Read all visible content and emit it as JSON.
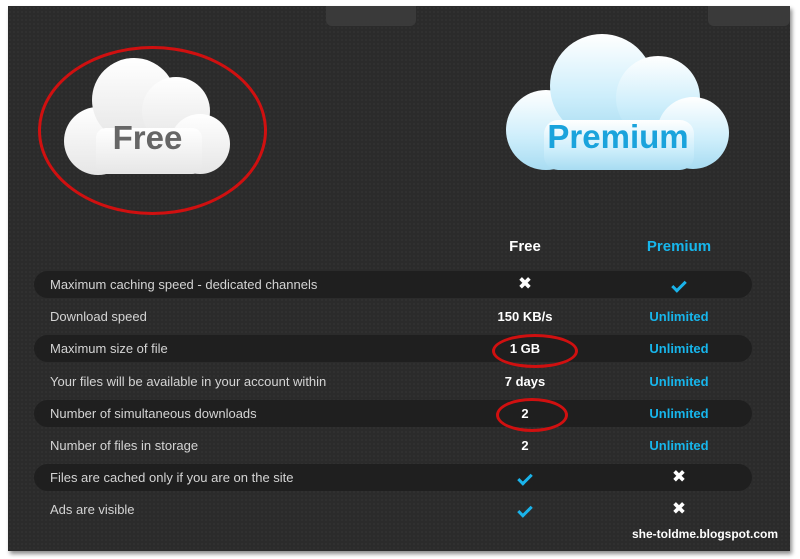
{
  "plans": {
    "free_cloud_label": "Free",
    "premium_cloud_label": "Premium"
  },
  "table": {
    "headers": {
      "free": "Free",
      "premium": "Premium"
    },
    "rows": [
      {
        "feature": "Maximum caching speed - dedicated channels",
        "free": {
          "type": "cross"
        },
        "premium": {
          "type": "check"
        }
      },
      {
        "feature": "Download speed",
        "free": {
          "type": "text",
          "value": "150 KB/s"
        },
        "premium": {
          "type": "text",
          "value": "Unlimited"
        }
      },
      {
        "feature": "Maximum size of file",
        "free": {
          "type": "text",
          "value": "1 GB"
        },
        "premium": {
          "type": "text",
          "value": "Unlimited"
        }
      },
      {
        "feature": "Your files will be available in your account within",
        "free": {
          "type": "text",
          "value": "7 days"
        },
        "premium": {
          "type": "text",
          "value": "Unlimited"
        }
      },
      {
        "feature": "Number of simultaneous downloads",
        "free": {
          "type": "text",
          "value": "2"
        },
        "premium": {
          "type": "text",
          "value": "Unlimited"
        }
      },
      {
        "feature": "Number of files in storage",
        "free": {
          "type": "text",
          "value": "2"
        },
        "premium": {
          "type": "text",
          "value": "Unlimited"
        }
      },
      {
        "feature": "Files are cached only if you are on the site",
        "free": {
          "type": "check"
        },
        "premium": {
          "type": "cross"
        }
      },
      {
        "feature": "Ads are visible",
        "free": {
          "type": "check"
        },
        "premium": {
          "type": "cross"
        }
      }
    ]
  },
  "watermark": "she-toldme.blogspot.com",
  "colors": {
    "background": "#2b2b2b",
    "accent_blue": "#17b6ec",
    "annotation_red": "#d01010"
  },
  "icons": {
    "check": "check-icon",
    "cross": "cross-icon"
  }
}
